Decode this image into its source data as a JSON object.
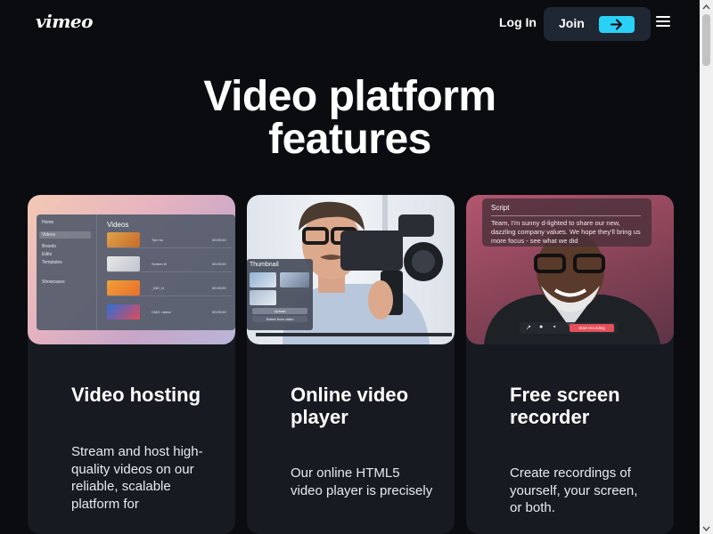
{
  "nav": {
    "logo": "vimeo",
    "login_label": "Log In",
    "join_label": "Join",
    "icons": {
      "join_arrow": "arrow-right-icon",
      "menu": "hamburger-menu-icon"
    },
    "colors": {
      "join_bg": "#1f2733",
      "join_arrow_bg": "#2ad1f6"
    }
  },
  "hero": {
    "title_line1": "Video platform",
    "title_line2": "features"
  },
  "cards": [
    {
      "title": "Video hosting",
      "description": "Stream and host high-quality videos on our reliable, scalable platform for",
      "image": {
        "sidebar": [
          "Home",
          "Videos",
          "Brands",
          "Edits",
          "Templates",
          "Showcases"
        ],
        "panel_title": "Videos",
        "rows": [
          {
            "name": "Tym hu",
            "date": "00:00:00"
          },
          {
            "name": "Screen ill",
            "date": "00:00:00"
          },
          {
            "name": "_INK_U",
            "date": "00:00:00"
          },
          {
            "name": "CMG. rdano",
            "date": "00:00:00"
          }
        ]
      }
    },
    {
      "title": "Online video player",
      "description": "Our online HTML5 video player is precisely",
      "image": {
        "panel_label": "Thumbnail",
        "upload_label": "Upload",
        "select_label": "Select from video"
      }
    },
    {
      "title": "Free screen recorder",
      "description": "Create recordings of yourself, your screen, or both.",
      "image": {
        "script_title": "Script",
        "script_text": "Team, I'm sunny d-lighted to share our new, dazzling company values. We hope they'll bring us more focus - see what we did",
        "record_label": "Start recording"
      }
    }
  ],
  "colors": {
    "page_bg": "#0b0c10",
    "card_bg": "#171a21",
    "record_btn": "#e3505a"
  }
}
